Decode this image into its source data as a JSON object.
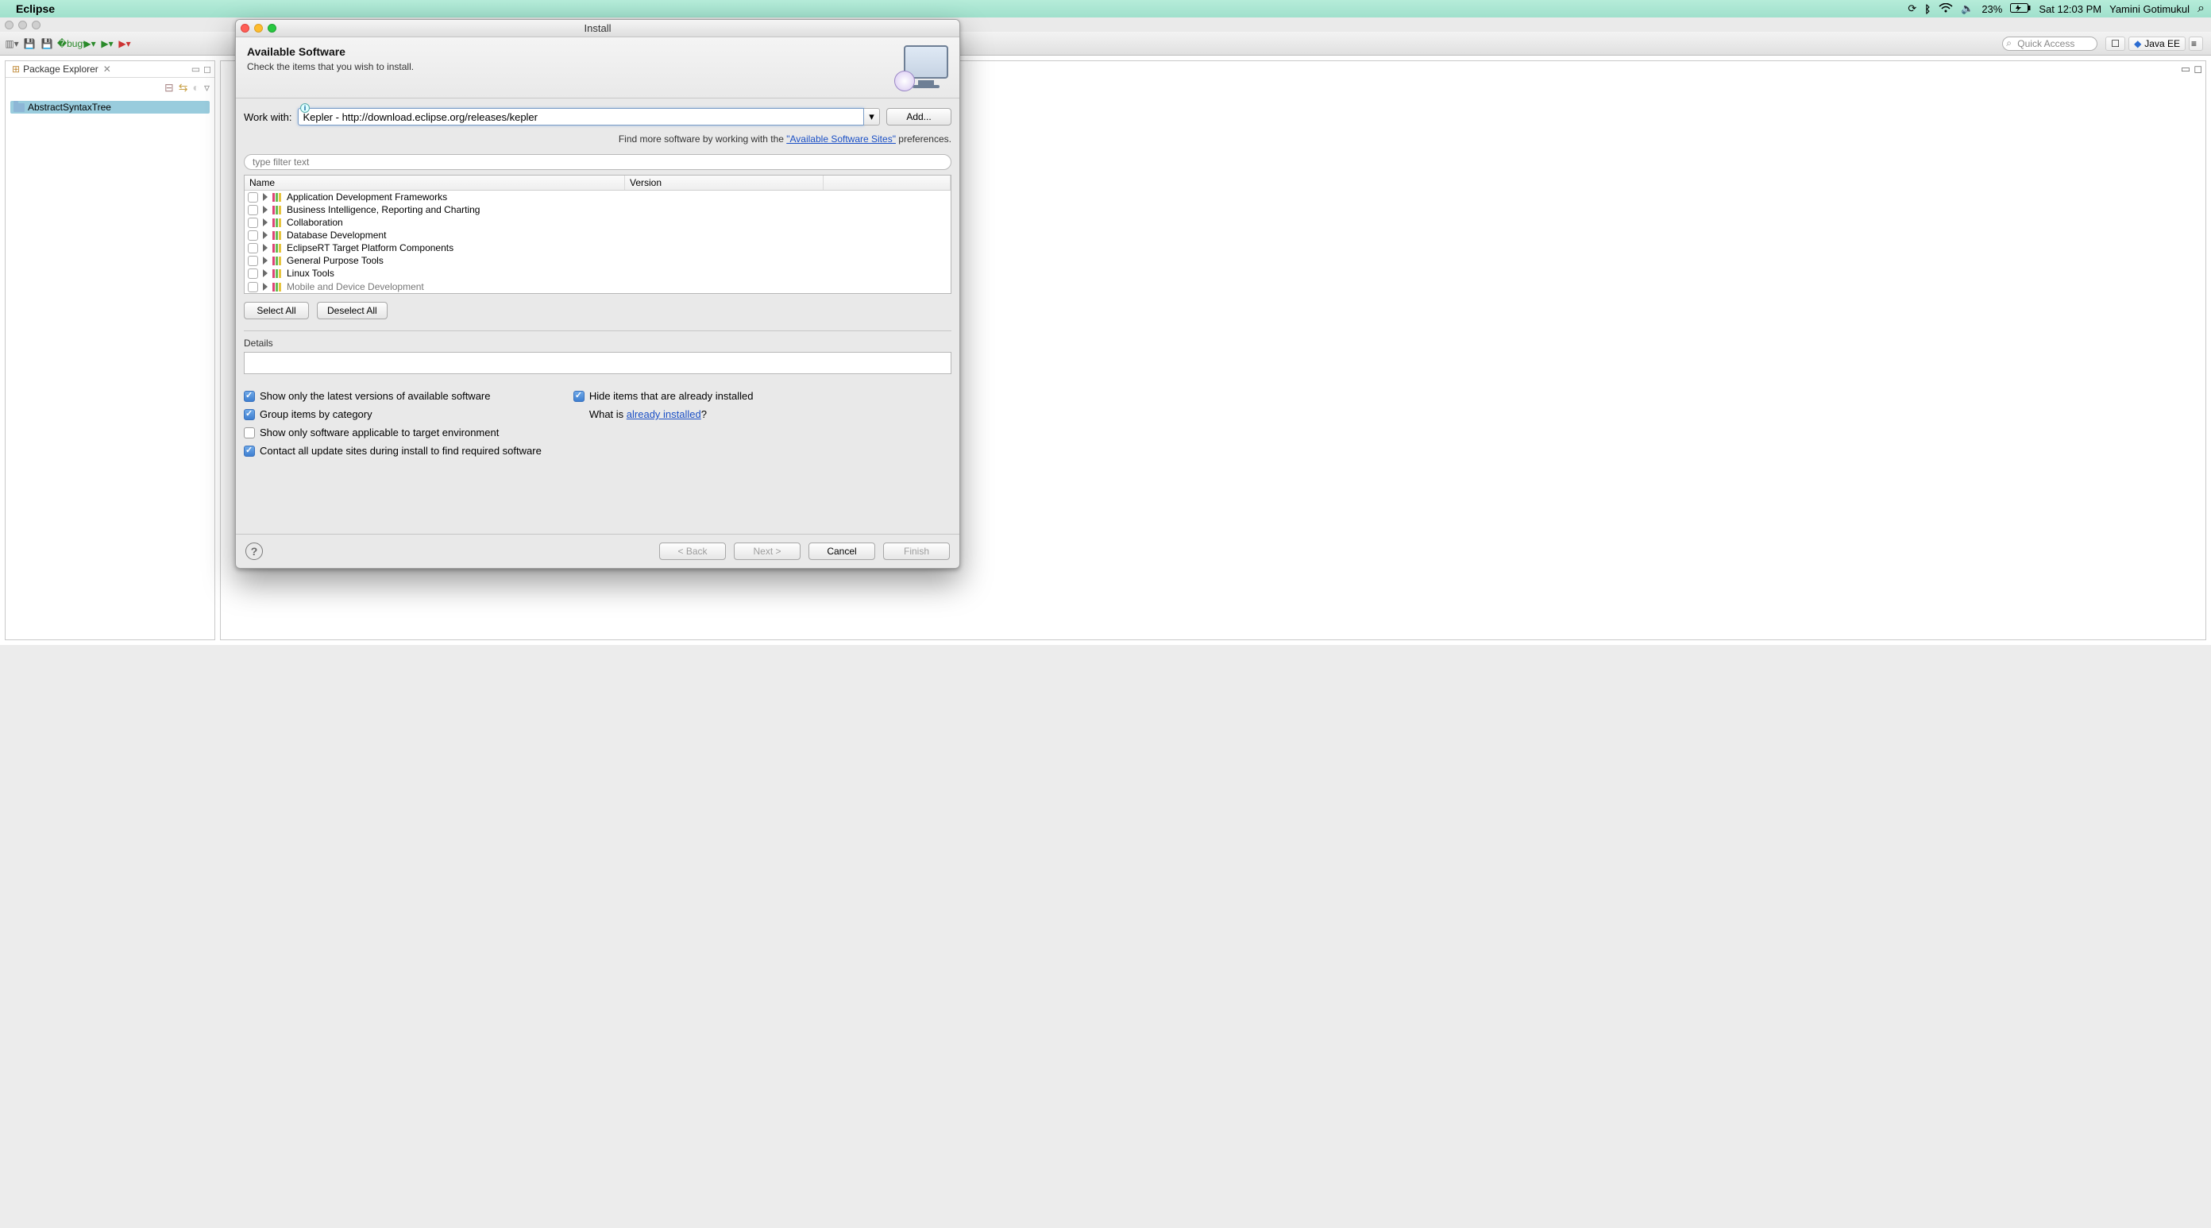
{
  "menubar": {
    "app": "Eclipse",
    "battery": "23%",
    "clock": "Sat 12:03 PM",
    "user": "Yamini Gotimukul"
  },
  "toolbar": {
    "quick_access": "Quick Access",
    "perspective": "Java EE"
  },
  "package_explorer": {
    "title": "Package Explorer",
    "project": "AbstractSyntaxTree"
  },
  "dialog": {
    "window_title": "Install",
    "title": "Available Software",
    "subtitle": "Check the items that you wish to install.",
    "work_with_label": "Work with:",
    "work_with_value": "Kepler - http://download.eclipse.org/releases/kepler",
    "add_btn": "Add...",
    "hint_pre": "Find more software by working with the ",
    "hint_link": "\"Available Software Sites\"",
    "hint_post": " preferences.",
    "filter_placeholder": "type filter text",
    "col_name": "Name",
    "col_version": "Version",
    "categories": [
      "Application Development Frameworks",
      "Business Intelligence, Reporting and Charting",
      "Collaboration",
      "Database Development",
      "EclipseRT Target Platform Components",
      "General Purpose Tools",
      "Linux Tools",
      "Mobile and Device Development"
    ],
    "select_all": "Select All",
    "deselect_all": "Deselect All",
    "details_label": "Details",
    "opt_latest": "Show only the latest versions of available software",
    "opt_group": "Group items by category",
    "opt_target": "Show only software applicable to target environment",
    "opt_contact": "Contact all update sites during install to find required software",
    "opt_hide": "Hide items that are already installed",
    "already_pre": "What is ",
    "already_link": "already installed",
    "already_post": "?",
    "btn_back": "< Back",
    "btn_next": "Next >",
    "btn_cancel": "Cancel",
    "btn_finish": "Finish"
  }
}
